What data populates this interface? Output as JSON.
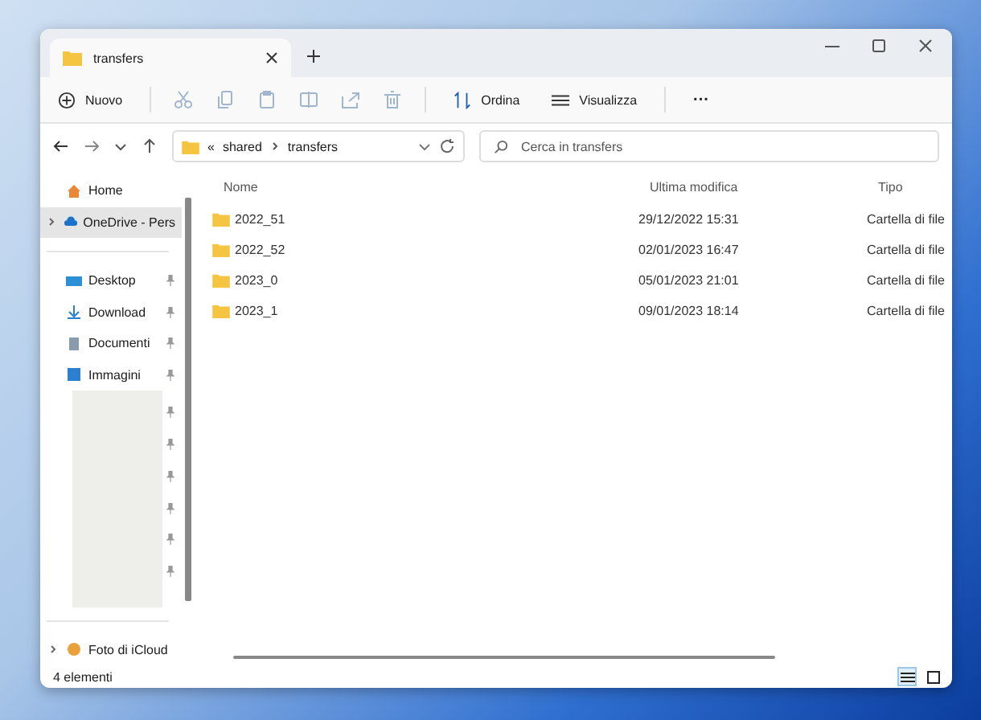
{
  "tabs": [
    {
      "label": "transfers",
      "selected": true
    }
  ],
  "toolbar": {
    "new_label": "Nuovo",
    "actions": [
      {
        "kind": "cut",
        "disabled": true
      },
      {
        "kind": "copy",
        "disabled": true
      },
      {
        "kind": "paste",
        "disabled": true
      },
      {
        "kind": "rename",
        "disabled": true
      },
      {
        "kind": "share",
        "disabled": true
      },
      {
        "kind": "delete",
        "disabled": true
      }
    ],
    "sort_label": "Ordina",
    "view_label": "Visualizza",
    "more": "···"
  },
  "address": {
    "overflow": "«",
    "crumbs": [
      "shared",
      "transfers"
    ]
  },
  "search": {
    "placeholder": "Cerca in transfers"
  },
  "sidebar": {
    "items": [
      {
        "label": "Home",
        "kind": "home",
        "selected": false,
        "expandable": false,
        "pinned": false
      },
      {
        "label": "OneDrive - Pers",
        "kind": "cloud",
        "selected": true,
        "expandable": true,
        "pinned": false
      },
      {
        "label": "Desktop",
        "kind": "desktop",
        "selected": false,
        "expandable": false,
        "pinned": true
      },
      {
        "label": "Download",
        "kind": "download",
        "selected": false,
        "expandable": false,
        "pinned": true
      },
      {
        "label": "Documenti",
        "kind": "documents",
        "selected": false,
        "expandable": false,
        "pinned": true
      },
      {
        "label": "Immagini",
        "kind": "pictures",
        "selected": false,
        "expandable": false,
        "pinned": true
      }
    ],
    "hidden_items": [
      {
        "pinned": true
      },
      {
        "pinned": true
      },
      {
        "pinned": true
      },
      {
        "pinned": true
      },
      {
        "pinned": true
      },
      {
        "pinned": true
      }
    ],
    "bottom_items": [
      {
        "label": "Foto di iCloud",
        "kind": "photos",
        "selected": false,
        "expandable": true,
        "pinned": false
      }
    ]
  },
  "table": {
    "columns": [
      "Nome",
      "Ultima modifica",
      "Tipo"
    ],
    "rows": [
      {
        "name": "2022_51",
        "modified": "29/12/2022 15:31",
        "type": "Cartella di file"
      },
      {
        "name": "2022_52",
        "modified": "02/01/2023 16:47",
        "type": "Cartella di file"
      },
      {
        "name": "2023_0",
        "modified": "05/01/2023 21:01",
        "type": "Cartella di file"
      },
      {
        "name": "2023_1",
        "modified": "09/01/2023 18:14",
        "type": "Cartella di file"
      }
    ]
  },
  "status_bar": {
    "text": "4 elementi",
    "view_modes": [
      {
        "kind": "details",
        "selected": true
      },
      {
        "kind": "tiles",
        "selected": false
      }
    ]
  }
}
